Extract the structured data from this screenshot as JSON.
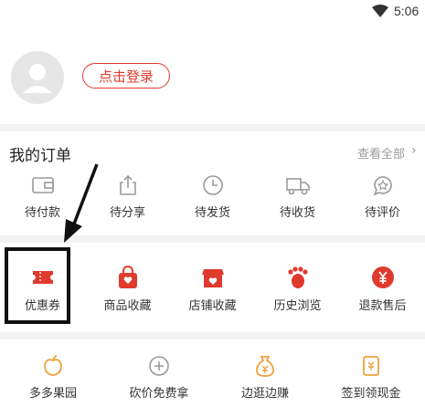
{
  "status_bar": {
    "time": "5:06"
  },
  "profile": {
    "login_label": "点击登录"
  },
  "orders": {
    "title": "我的订单",
    "view_all": "查看全部",
    "chevron": "›",
    "items": [
      {
        "label": "待付款",
        "icon": "wallet-icon"
      },
      {
        "label": "待分享",
        "icon": "share-icon"
      },
      {
        "label": "待发货",
        "icon": "clock-icon"
      },
      {
        "label": "待收货",
        "icon": "truck-icon"
      },
      {
        "label": "待评价",
        "icon": "review-icon"
      }
    ]
  },
  "favorites": {
    "items": [
      {
        "label": "优惠券",
        "icon": "coupon-icon"
      },
      {
        "label": "商品收藏",
        "icon": "product-favorite-icon"
      },
      {
        "label": "店铺收藏",
        "icon": "shop-favorite-icon"
      },
      {
        "label": "历史浏览",
        "icon": "footprint-icon"
      },
      {
        "label": "退款售后",
        "icon": "refund-icon"
      }
    ]
  },
  "services": {
    "items": [
      {
        "label": "多多果园",
        "icon": "orchard-icon"
      },
      {
        "label": "砍价免费拿",
        "icon": "bargain-icon"
      },
      {
        "label": "边逛边赚",
        "icon": "earn-icon"
      },
      {
        "label": "签到领现金",
        "icon": "checkin-icon"
      }
    ]
  },
  "colors": {
    "accent": "#e03a2e",
    "outline_icon": "#9a9a9a",
    "text": "#333333"
  }
}
